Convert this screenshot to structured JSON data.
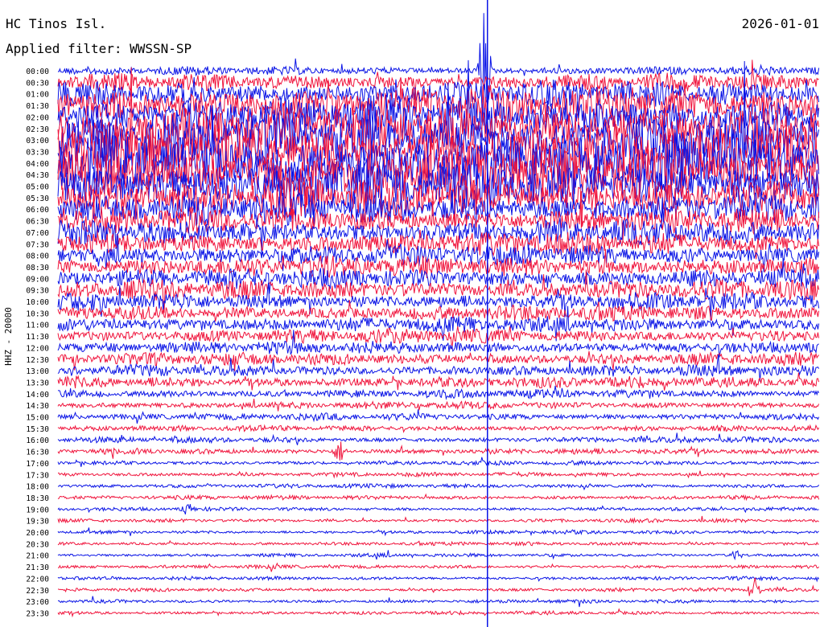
{
  "header": {
    "station": "HC Tinos Isl.",
    "date": "2026-01-01",
    "filter": "Applied filter: WWSSN-SP"
  },
  "chart_data": {
    "type": "line",
    "title": "HC Tinos Isl.",
    "subtitle": "Applied filter: WWSSN-SP",
    "ylabel": "HHZ - 20000",
    "colors": [
      "#0a14e6",
      "#f0143c"
    ],
    "row_labels": [
      "00:00",
      "00:30",
      "01:00",
      "01:30",
      "02:00",
      "02:30",
      "03:00",
      "03:30",
      "04:00",
      "04:30",
      "05:00",
      "05:30",
      "06:00",
      "06:30",
      "07:00",
      "07:30",
      "08:00",
      "08:30",
      "09:00",
      "09:30",
      "10:00",
      "10:30",
      "11:00",
      "11:30",
      "12:00",
      "12:30",
      "13:00",
      "13:30",
      "14:00",
      "14:30",
      "15:00",
      "15:30",
      "16:00",
      "16:30",
      "17:00",
      "17:30",
      "18:00",
      "18:30",
      "19:00",
      "19:30",
      "20:00",
      "20:30",
      "21:00",
      "21:30",
      "22:00",
      "22:30",
      "23:00",
      "23:30"
    ],
    "amplitude": [
      6,
      12,
      18,
      26,
      30,
      34,
      36,
      38,
      40,
      40,
      36,
      28,
      22,
      18,
      17,
      16,
      15,
      15,
      14,
      14,
      12,
      11,
      11,
      10,
      9,
      9,
      8,
      8,
      6,
      5,
      5,
      4,
      4,
      4,
      3,
      3,
      3,
      3,
      2.5,
      2.5,
      2.5,
      2.5,
      2.5,
      2.5,
      2.5,
      2.5,
      2.5,
      2.5
    ],
    "events": [
      {
        "row": 0,
        "x_frac": 0.56,
        "amp": 80
      },
      {
        "row": 33,
        "x_frac": 0.37,
        "amp": 14
      },
      {
        "row": 38,
        "x_frac": 0.17,
        "amp": 7
      },
      {
        "row": 42,
        "x_frac": 0.89,
        "amp": 6
      },
      {
        "row": 45,
        "x_frac": 0.915,
        "amp": 18
      }
    ]
  }
}
